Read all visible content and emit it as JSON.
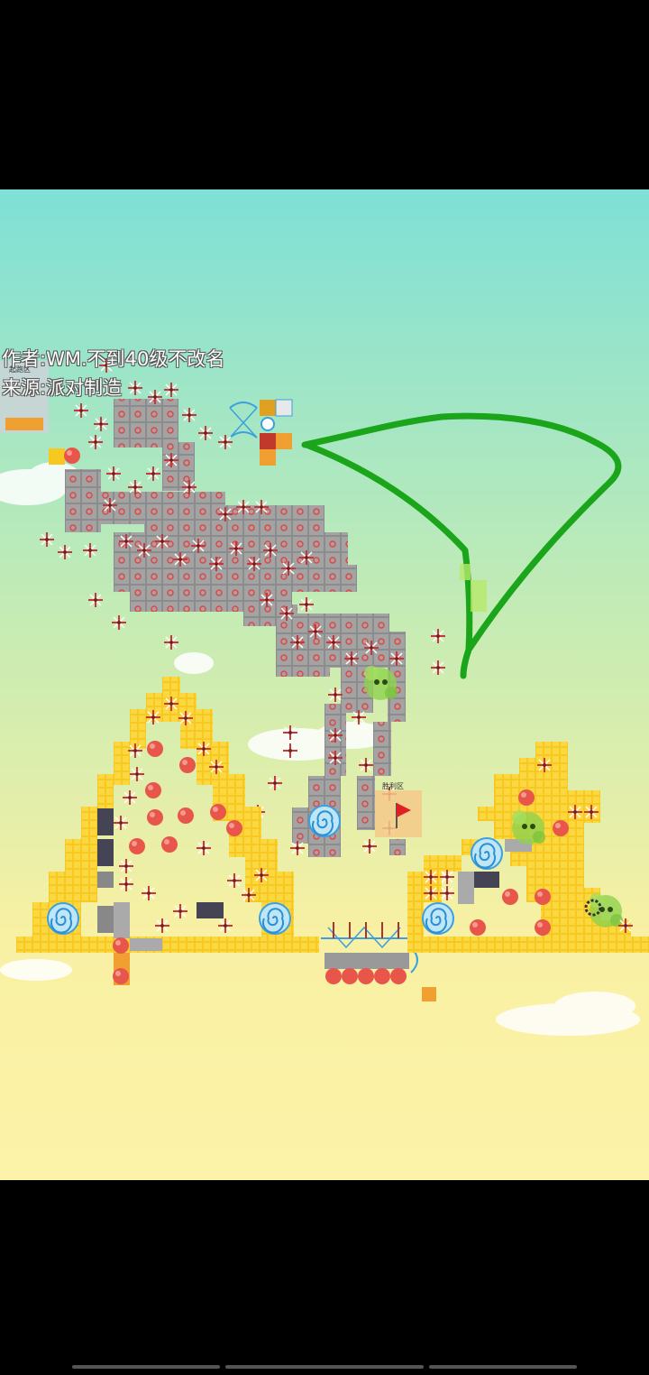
{
  "credits": {
    "author": "作者:WM.不到40级不改名",
    "source": "来源:派对制造"
  },
  "zones": {
    "start": "起跑区",
    "finish": "胜利区"
  },
  "colors": {
    "sky_top": "#7ee0d6",
    "sky_bottom": "#fdf3a3",
    "block_yellow": "#f7c820",
    "machine_gray": "#8f8f8f",
    "annotation_green": "#1aa51a",
    "spiral_blue": "#3aa0e0"
  },
  "icons": [
    "crossbow-icon",
    "spinning-blade-icon",
    "spiral-portal-icon",
    "red-flag-icon",
    "green-slime-icon",
    "red-bomb-icon",
    "gear-icon"
  ]
}
